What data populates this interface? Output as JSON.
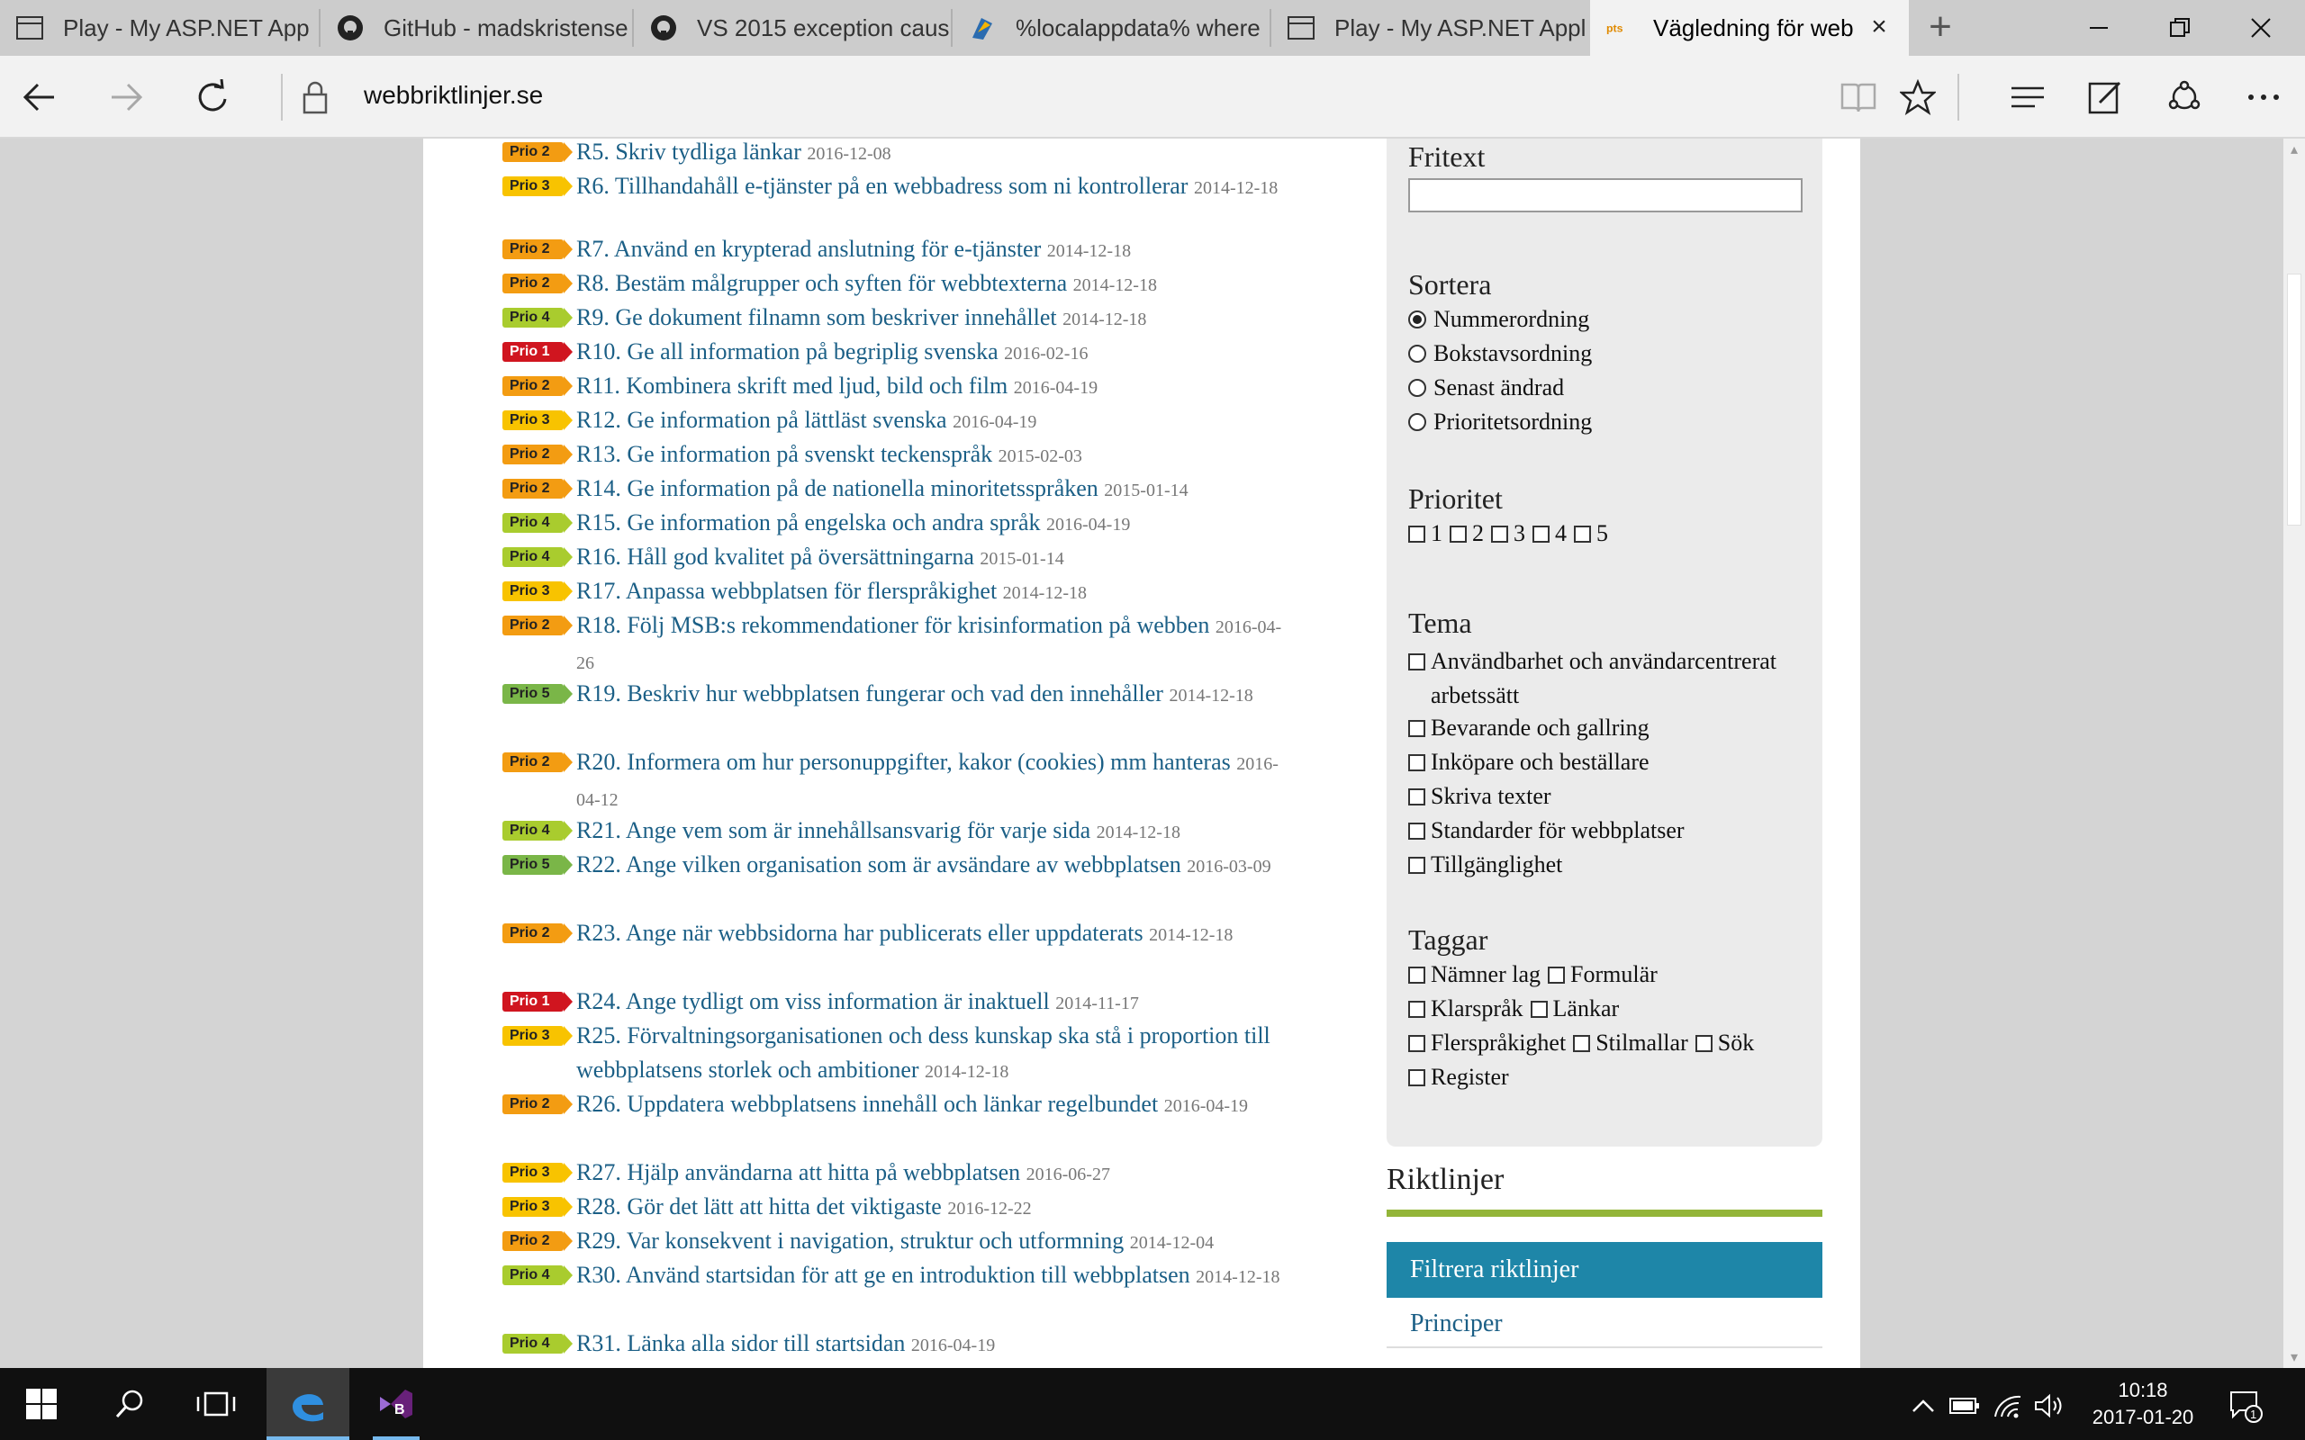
{
  "tabs": [
    {
      "title": "Play - My ASP.NET App",
      "icon": "page-icon"
    },
    {
      "title": "GitHub - madskristense",
      "icon": "github-icon"
    },
    {
      "title": "VS 2015 exception caus",
      "icon": "github-icon"
    },
    {
      "title": "%localappdata% where",
      "icon": "blog-icon"
    },
    {
      "title": "Play - My ASP.NET Appl",
      "icon": "page-icon"
    },
    {
      "title": "Vägledning för web",
      "icon": "pts-icon"
    }
  ],
  "address": {
    "url": "webbriktlinjer.se"
  },
  "guidelines": [
    {
      "prio": "Prio 2",
      "level": 2,
      "title": "R5. Skriv tydliga länkar",
      "date": "2016-12-08"
    },
    {
      "prio": "Prio 3",
      "level": 3,
      "title": "R6. Tillhandahåll e-tjänster på en webbadress som ni kontrollerar",
      "date": "2014-12-18"
    },
    {
      "prio": "Prio 2",
      "level": 2,
      "title": "R7. Använd en krypterad anslutning för e-tjänster",
      "date": "2014-12-18"
    },
    {
      "prio": "Prio 2",
      "level": 2,
      "title": "R8. Bestäm målgrupper och syften för webbtexterna",
      "date": "2014-12-18"
    },
    {
      "prio": "Prio 4",
      "level": 4,
      "title": "R9. Ge dokument filnamn som beskriver innehållet",
      "date": "2014-12-18"
    },
    {
      "prio": "Prio 1",
      "level": 1,
      "title": "R10. Ge all information på begriplig svenska",
      "date": "2016-02-16"
    },
    {
      "prio": "Prio 2",
      "level": 2,
      "title": "R11. Kombinera skrift med ljud, bild och film",
      "date": "2016-04-19"
    },
    {
      "prio": "Prio 3",
      "level": 3,
      "title": "R12. Ge information på lättläst svenska",
      "date": "2016-04-19"
    },
    {
      "prio": "Prio 2",
      "level": 2,
      "title": "R13. Ge information på svenskt teckenspråk",
      "date": "2015-02-03"
    },
    {
      "prio": "Prio 2",
      "level": 2,
      "title": "R14. Ge information på de nationella minoritetsspråken",
      "date": "2015-01-14"
    },
    {
      "prio": "Prio 4",
      "level": 4,
      "title": "R15. Ge information på engelska och andra språk",
      "date": "2016-04-19"
    },
    {
      "prio": "Prio 4",
      "level": 4,
      "title": "R16. Håll god kvalitet på översättningarna",
      "date": "2015-01-14"
    },
    {
      "prio": "Prio 3",
      "level": 3,
      "title": "R17. Anpassa webbplatsen för flerspråkighet",
      "date": "2014-12-18"
    },
    {
      "prio": "Prio 2",
      "level": 2,
      "title": "R18. Följ MSB:s rekommendationer för krisinformation på webben",
      "date": "2016-04-26"
    },
    {
      "prio": "Prio 5",
      "level": 5,
      "title": "R19. Beskriv hur webbplatsen fungerar och vad den innehåller",
      "date": "2014-12-18"
    },
    {
      "prio": "Prio 2",
      "level": 2,
      "title": "R20. Informera om hur personuppgifter, kakor (cookies) mm hanteras",
      "date": "2016-04-12"
    },
    {
      "prio": "Prio 4",
      "level": 4,
      "title": "R21. Ange vem som är innehållsansvarig för varje sida",
      "date": "2014-12-18"
    },
    {
      "prio": "Prio 5",
      "level": 5,
      "title": "R22. Ange vilken organisation som är avsändare av webbplatsen",
      "date": "2016-03-09"
    },
    {
      "prio": "Prio 2",
      "level": 2,
      "title": "R23. Ange när webbsidorna har publicerats eller uppdaterats",
      "date": "2014-12-18"
    },
    {
      "prio": "Prio 1",
      "level": 1,
      "title": "R24. Ange tydligt om viss information är inaktuell",
      "date": "2014-11-17"
    },
    {
      "prio": "Prio 3",
      "level": 3,
      "title": "R25. Förvaltningsorganisationen och dess kunskap ska stå i proportion till webbplatsens storlek och ambitioner",
      "date": "2014-12-18"
    },
    {
      "prio": "Prio 2",
      "level": 2,
      "title": "R26. Uppdatera webbplatsens innehåll och länkar regelbundet",
      "date": "2016-04-19"
    },
    {
      "prio": "Prio 3",
      "level": 3,
      "title": "R27. Hjälp användarna att hitta på webbplatsen",
      "date": "2016-06-27"
    },
    {
      "prio": "Prio 3",
      "level": 3,
      "title": "R28. Gör det lätt att hitta det viktigaste",
      "date": "2016-12-22"
    },
    {
      "prio": "Prio 2",
      "level": 2,
      "title": "R29. Var konsekvent i navigation, struktur och utformning",
      "date": "2014-12-04"
    },
    {
      "prio": "Prio 4",
      "level": 4,
      "title": "R30. Använd startsidan för att ge en introduktion till webbplatsen",
      "date": "2014-12-18"
    },
    {
      "prio": "Prio 4",
      "level": 4,
      "title": "R31. Länka alla sidor till startsidan",
      "date": "2016-04-19"
    }
  ],
  "filter": {
    "fritext_label": "Fritext",
    "fritext_value": "",
    "sort_label": "Sortera",
    "sort_options": [
      "Nummerordning",
      "Bokstavsordning",
      "Senast ändrad",
      "Prioritetsordning"
    ],
    "sort_selected": "Nummerordning",
    "priority_label": "Prioritet",
    "priority_options": [
      "1",
      "2",
      "3",
      "4",
      "5"
    ],
    "theme_label": "Tema",
    "theme_options": [
      "Användbarhet och användarcentrerat arbetssätt",
      "Bevarande och gallring",
      "Inköpare och beställare",
      "Skriva texter",
      "Standarder för webbplatser",
      "Tillgänglighet"
    ],
    "tags_label": "Taggar",
    "tags": [
      "Nämner lag",
      "Formulär",
      "Klarspråk",
      "Länkar",
      "Flerspråkighet",
      "Stilmallar",
      "Sök",
      "Register"
    ]
  },
  "sidebar_nav": {
    "title": "Riktlinjer",
    "active_item": "Filtrera riktlinjer",
    "next_item": "Principer"
  },
  "taskbar": {
    "time": "10:18",
    "date": "2017-01-20",
    "notification_count": "1"
  }
}
